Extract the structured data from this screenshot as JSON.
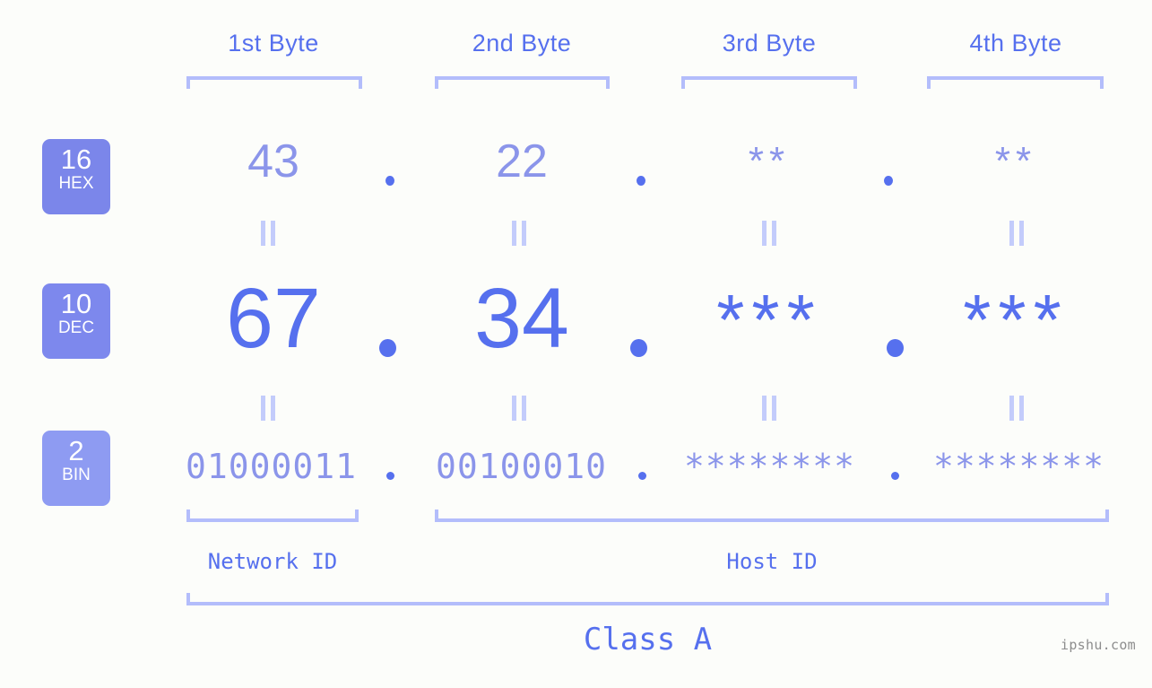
{
  "background": "#fcfdfa",
  "colors": {
    "accent_strong": "#5670ee",
    "accent_soft": "#8b95ea",
    "bracket": "#b3bdfb",
    "equals": "#c3ccfb",
    "badge_hex": "#7b86ea",
    "badge_dec": "#7d88ed",
    "badge_bin": "#8e9bf2",
    "watermark": "#8d8d8d"
  },
  "byte_headers": [
    {
      "label": "1st Byte"
    },
    {
      "label": "2nd Byte"
    },
    {
      "label": "3rd Byte"
    },
    {
      "label": "4th Byte"
    }
  ],
  "bases": [
    {
      "number": "16",
      "abbr": "HEX"
    },
    {
      "number": "10",
      "abbr": "DEC"
    },
    {
      "number": "2",
      "abbr": "BIN"
    }
  ],
  "rows": {
    "hex": {
      "base_number": "16",
      "base_abbr": "HEX",
      "values": [
        "43",
        "22",
        "**",
        "**"
      ],
      "separator": "."
    },
    "dec": {
      "base_number": "10",
      "base_abbr": "DEC",
      "values": [
        "67",
        "34",
        "***",
        "***"
      ],
      "separator": "."
    },
    "bin": {
      "base_number": "2",
      "base_abbr": "BIN",
      "values": [
        "01000011",
        "00100010",
        "********",
        "********"
      ],
      "separator": "."
    }
  },
  "equals_glyph": "=",
  "sections": {
    "network_id": "Network ID",
    "host_id": "Host ID",
    "class": "Class A"
  },
  "watermark": "ipshu.com"
}
